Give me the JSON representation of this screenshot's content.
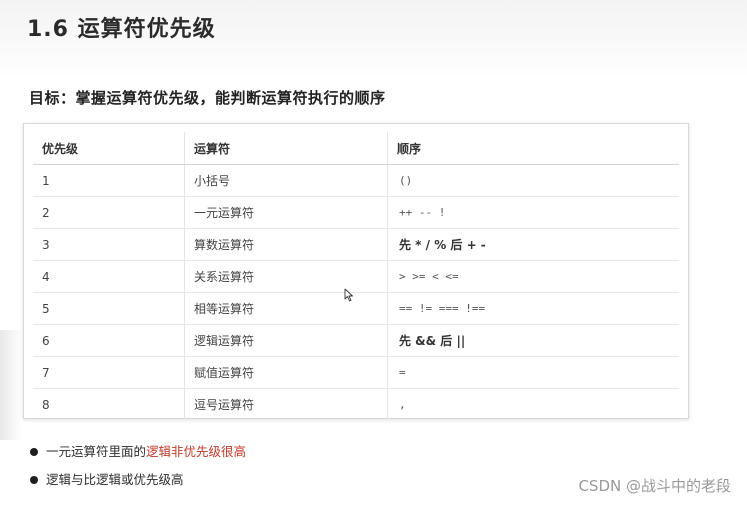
{
  "slide": {
    "title": "1.6 运算符优先级",
    "goal": "目标：掌握运算符优先级，能判断运算符执行的顺序"
  },
  "table": {
    "headers": [
      "优先级",
      "运算符",
      "顺序"
    ],
    "rows": [
      {
        "priority": "1",
        "operator": "小括号",
        "order": "()"
      },
      {
        "priority": "2",
        "operator": "一元运算符",
        "order": "++  --  !"
      },
      {
        "priority": "3",
        "operator": "算数运算符",
        "order": "先 * / %  后 + -"
      },
      {
        "priority": "4",
        "operator": "关系运算符",
        "order": ">  >=  <  <="
      },
      {
        "priority": "5",
        "operator": "相等运算符",
        "order": "==  !=   ===   !=="
      },
      {
        "priority": "6",
        "operator": "逻辑运算符",
        "order": "先 &&  后 ||"
      },
      {
        "priority": "7",
        "operator": "赋值运算符",
        "order": "="
      },
      {
        "priority": "8",
        "operator": "逗号运算符",
        "order": ","
      }
    ]
  },
  "notes": {
    "bullet1_prefix": "一元运算符里面的",
    "bullet1_highlight": "逻辑非优先级很高",
    "bullet2": "逻辑与比逻辑或优先级高"
  },
  "watermark": "CSDN @战斗中的老段",
  "colors": {
    "highlight": "#c0392b",
    "header_band": "#f3f3f3"
  }
}
